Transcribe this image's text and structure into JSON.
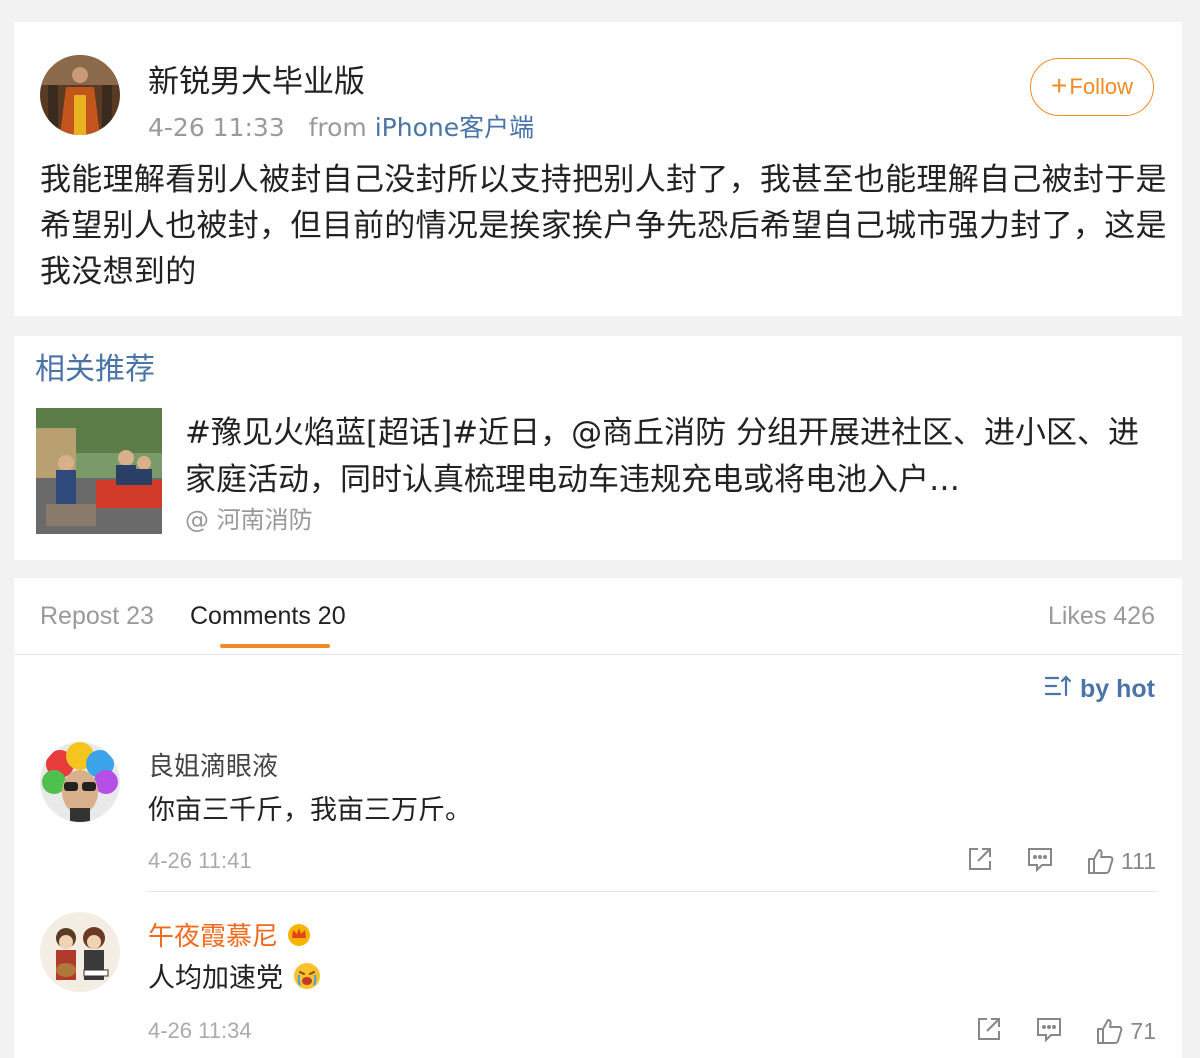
{
  "post": {
    "username": "新锐男大毕业版",
    "timestamp": "4-26 11:33",
    "from_prefix": "from",
    "source": "iPhone客户端",
    "follow_label": "Follow",
    "text": "我能理解看别人被封自己没封所以支持把别人封了，我甚至也能理解自己被封于是希望别人也被封，但目前的情况是挨家挨户争先恐后希望自己城市强力封了，这是我没想到的"
  },
  "related": {
    "section_title": "相关推荐",
    "text": "#豫见火焰蓝[超话]#近日，@商丘消防 分组开展进社区、进小区、进家庭活动，同时认真梳理电动车违规充电或将电池入户…",
    "source": "@ 河南消防"
  },
  "tabs": {
    "repost_label": "Repost 23",
    "comments_label": "Comments 20",
    "likes_label": "Likes 426"
  },
  "sort_label": "by hot",
  "comments": [
    {
      "name": "良姐滴眼液",
      "text": "你亩三千斤，我亩三万斤。",
      "time": "4-26 11:41",
      "likes": "111"
    },
    {
      "name": "午夜霞慕尼",
      "text": "人均加速党",
      "time": "4-26 11:34",
      "likes": "71"
    }
  ],
  "colors": {
    "accent_orange": "#f08a24",
    "link_blue": "#4a74a8",
    "vip_name": "#f26b1d"
  }
}
